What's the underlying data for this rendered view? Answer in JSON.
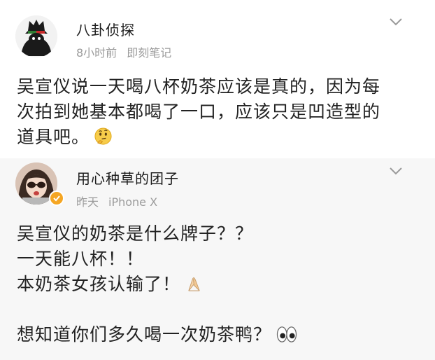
{
  "posts": [
    {
      "author": "八卦侦探",
      "time": "8小时前",
      "source": "即刻笔记",
      "lines": [
        "吴宣仪说一天喝八杯奶茶应该是真的，因为每",
        "次拍到她基本都喝了一口，应该只是凹造型的",
        "道具吧。"
      ],
      "emoji": "thinking-face"
    },
    {
      "author": "用心种草的团子",
      "time": "昨天",
      "source": "iPhone X",
      "lines": [
        "吴宣仪的奶茶是什么牌子？？",
        "一天能八杯！！",
        "本奶茶女孩认输了！",
        "",
        "想知道你们多久喝一次奶茶鸭？"
      ],
      "emojis": [
        "folded-hands",
        "eyes"
      ],
      "verified": true
    }
  ],
  "colors": {
    "text": "#222222",
    "meta": "#9b9b9b",
    "verified_badge": "#f5a623"
  }
}
